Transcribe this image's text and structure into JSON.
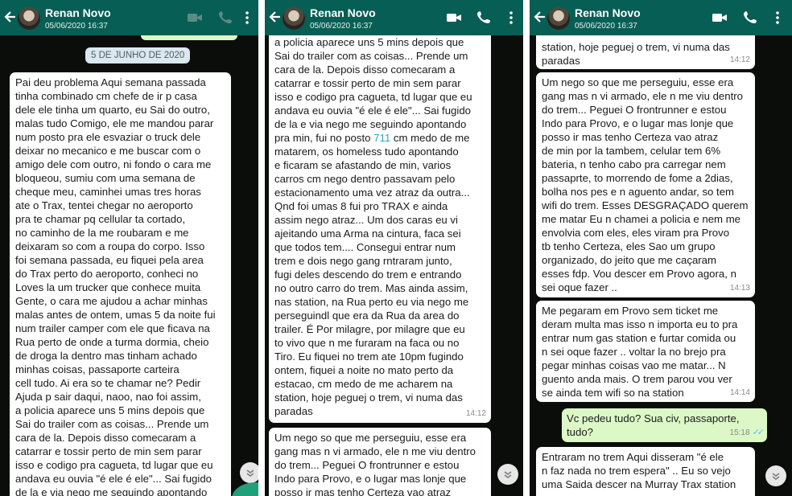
{
  "panels": [
    {
      "header": {
        "name": "Renan Novo",
        "status": "05/06/2020 16:37",
        "icons": [
          "back-arrow-icon",
          "video-call-icon",
          "phone-icon",
          "menu-dots-icon"
        ]
      },
      "date_chip": "5 DE JUNHO DE 2020",
      "message1_lines": [
        "Pai deu problema Aqui semana passada",
        "tinha combinado cm chefe de ir p casa",
        "dele ele tinha um quarto, eu Sai do outro,",
        "malas tudo Comigo, ele me mandou parar",
        "num posto pra ele esvaziar o truck dele",
        "deixar no mecanico e me buscar com o",
        "amigo dele com outro, ni fondo o cara me",
        "bloqueou, sumiu com uma semana de",
        "cheque meu, caminhei umas tres horas",
        "ate o Trax, tentei chegar no aeroporto",
        "pra te chamar pq cellular ta cortado,",
        "no caminho de la me roubaram e me",
        "deixaram so com a roupa do corpo. Isso",
        "foi semana passada, eu fiquei pela area",
        "do Trax perto do aeroporto, conheci no",
        "Loves la um trucker que conhece muita",
        "Gente, o cara me ajudou a achar minhas",
        "malas antes de ontem, umas 5 da noite fui",
        "num trailer camper com ele que ficava na",
        "Rua perto de onde a turma dormia, cheio",
        "de droga la dentro mas tinham achado",
        "minhas coisas, passaporte carteira",
        "cell tudo. Ai era so te chamar ne? Pedir",
        "Ajuda p sair daqui, naoo, nao foi assim,",
        "a policia aparece uns 5 mins depois que",
        "Sai do trailer com as coisas... Prende um",
        "cara de la. Depois disso comecaram a",
        "catarrar e tossir perto de min sem parar",
        "isso e codigo pra cagueta, td lugar que eu",
        "andava eu ouvia \"é ele é ele\"... Sai fugido",
        "de la e via nego me seguindo apontando"
      ]
    },
    {
      "header": {
        "name": "Renan Novo",
        "status": "05/06/2020 16:37"
      },
      "message1_lines": [
        "a policia aparece uns 5 mins depois que",
        "Sai do trailer com as coisas... Prende um",
        "cara de la. Depois disso comecaram a",
        "catarrar e tossir perto de min sem parar",
        "isso e codigo pra cagueta, td lugar que eu",
        "andava eu ouvia \"é ele é ele\"... Sai fugido",
        "de la e via nego me seguindo apontando",
        "pra min, fui no posto",
        "cm medo de me",
        "matarem, os homeless tudo apontando",
        "e ficaram se afastando de min, varios",
        "carros cm nego dentro passavam pelo",
        "estacionamento uma vez atraz da outra...",
        "Qnd foi umas 8 fui pro TRAX e ainda",
        "assim nego atraz... Um dos caras eu vi",
        "ajeitando uma Arma na cintura, faca sei",
        "que todos tem.... Consegui entrar num",
        "trem e dois nego gang rntraram junto,",
        "fugi deles descendo do trem e entrando",
        "no outro carro do trem. Mas ainda assim,",
        "nas station, na Rua perto eu via nego me",
        "perseguindl que era da Rua da area do",
        "trailer. É Por milagre, por milagre que eu",
        "to vivo que n me furaram na faca ou no",
        "Tiro. Eu fiquei no trem ate 10pm fugindo",
        "ontem, fiquei a noite no mato perto da",
        "estacao, cm medo de me acharem na",
        "station, hoje peguej o trem, vi numa das",
        "paradas"
      ],
      "link_number": "711",
      "message1_time": "14:12",
      "message2_lines": [
        "Um nego so que me perseguiu, esse era",
        "gang mas n vi armado, ele n me viu dentro",
        "do trem... Peguei O frontrunner e estou",
        "Indo para Provo, e o lugar mas lonje que",
        "posso ir mas tenho Certeza vao atraz"
      ]
    },
    {
      "header": {
        "name": "Renan Novo",
        "status": "05/06/2020 16:37"
      },
      "message1_lines": [
        "station, hoje peguej o trem, vi numa das",
        "paradas"
      ],
      "message1_time": "14:12",
      "message2_lines": [
        "Um nego so que me perseguiu, esse era",
        "gang mas n vi armado, ele n me viu dentro",
        "do trem... Peguei O frontrunner e estou",
        "Indo para Provo, e o lugar mas lonje que",
        "posso ir mas tenho Certeza vao atraz",
        "de min por la tambem, celular tem 6%",
        "bateria, n tenho cabo pra carregar nem",
        "passaprte, to morrendo de fome a 2dias,",
        "bolha nos pes e n aguento andar, so tem",
        "wifi do trem. Esses DESGRAÇADO querem",
        "me matar Eu n chamei a policia e nem me",
        "envolvia com eles, eles viram pra Provo",
        "tb tenho Certeza, eles Sao um grupo",
        "organizado, do jeito que me caçaram",
        "esses fdp. Vou descer em Provo agora, n",
        "sei oque fazer .."
      ],
      "message2_time": "14:13",
      "message3_lines": [
        "Me pegaram em Provo sem ticket me",
        "deram multa mas isso n importa eu to pra",
        "entrar num gas station e furtar comida ou",
        "n sei oque fazer .. voltar la no brejo pra",
        "pegar minhas coisas vao me matar... N",
        "guento anda mais. O trem parou vou ver",
        "se ainda tem wifi so na station"
      ],
      "message3_time": "14:14",
      "sent_lines": [
        "Vc pedeu tudo? Sua civ, passaporte,",
        "tudo?"
      ],
      "sent_time": "15:18",
      "message4_lines": [
        "Entraram no trem Aqui disseram \"é ele",
        "n faz nada no trem espera\" .. Eu so vejo",
        "uma Saida descer na Murray Trax station"
      ]
    }
  ],
  "colors": {
    "header": "#075e54",
    "chat_bg": "#0b0d0b",
    "incoming": "#ffffff",
    "outgoing": "#dcf8c6",
    "read_ticks": "#4fc3f7",
    "link": "#2aa7c9"
  }
}
